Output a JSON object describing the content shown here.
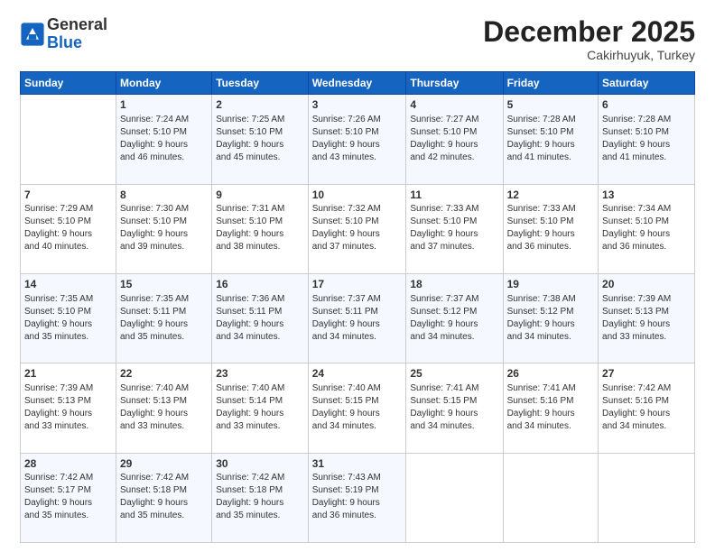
{
  "logo": {
    "general": "General",
    "blue": "Blue"
  },
  "title": {
    "month": "December 2025",
    "location": "Cakirhuyuk, Turkey"
  },
  "days_of_week": [
    "Sunday",
    "Monday",
    "Tuesday",
    "Wednesday",
    "Thursday",
    "Friday",
    "Saturday"
  ],
  "weeks": [
    [
      {
        "day": "",
        "content": ""
      },
      {
        "day": "1",
        "content": "Sunrise: 7:24 AM\nSunset: 5:10 PM\nDaylight: 9 hours\nand 46 minutes."
      },
      {
        "day": "2",
        "content": "Sunrise: 7:25 AM\nSunset: 5:10 PM\nDaylight: 9 hours\nand 45 minutes."
      },
      {
        "day": "3",
        "content": "Sunrise: 7:26 AM\nSunset: 5:10 PM\nDaylight: 9 hours\nand 43 minutes."
      },
      {
        "day": "4",
        "content": "Sunrise: 7:27 AM\nSunset: 5:10 PM\nDaylight: 9 hours\nand 42 minutes."
      },
      {
        "day": "5",
        "content": "Sunrise: 7:28 AM\nSunset: 5:10 PM\nDaylight: 9 hours\nand 41 minutes."
      },
      {
        "day": "6",
        "content": "Sunrise: 7:28 AM\nSunset: 5:10 PM\nDaylight: 9 hours\nand 41 minutes."
      }
    ],
    [
      {
        "day": "7",
        "content": "Sunrise: 7:29 AM\nSunset: 5:10 PM\nDaylight: 9 hours\nand 40 minutes."
      },
      {
        "day": "8",
        "content": "Sunrise: 7:30 AM\nSunset: 5:10 PM\nDaylight: 9 hours\nand 39 minutes."
      },
      {
        "day": "9",
        "content": "Sunrise: 7:31 AM\nSunset: 5:10 PM\nDaylight: 9 hours\nand 38 minutes."
      },
      {
        "day": "10",
        "content": "Sunrise: 7:32 AM\nSunset: 5:10 PM\nDaylight: 9 hours\nand 37 minutes."
      },
      {
        "day": "11",
        "content": "Sunrise: 7:33 AM\nSunset: 5:10 PM\nDaylight: 9 hours\nand 37 minutes."
      },
      {
        "day": "12",
        "content": "Sunrise: 7:33 AM\nSunset: 5:10 PM\nDaylight: 9 hours\nand 36 minutes."
      },
      {
        "day": "13",
        "content": "Sunrise: 7:34 AM\nSunset: 5:10 PM\nDaylight: 9 hours\nand 36 minutes."
      }
    ],
    [
      {
        "day": "14",
        "content": "Sunrise: 7:35 AM\nSunset: 5:10 PM\nDaylight: 9 hours\nand 35 minutes."
      },
      {
        "day": "15",
        "content": "Sunrise: 7:35 AM\nSunset: 5:11 PM\nDaylight: 9 hours\nand 35 minutes."
      },
      {
        "day": "16",
        "content": "Sunrise: 7:36 AM\nSunset: 5:11 PM\nDaylight: 9 hours\nand 34 minutes."
      },
      {
        "day": "17",
        "content": "Sunrise: 7:37 AM\nSunset: 5:11 PM\nDaylight: 9 hours\nand 34 minutes."
      },
      {
        "day": "18",
        "content": "Sunrise: 7:37 AM\nSunset: 5:12 PM\nDaylight: 9 hours\nand 34 minutes."
      },
      {
        "day": "19",
        "content": "Sunrise: 7:38 AM\nSunset: 5:12 PM\nDaylight: 9 hours\nand 34 minutes."
      },
      {
        "day": "20",
        "content": "Sunrise: 7:39 AM\nSunset: 5:13 PM\nDaylight: 9 hours\nand 33 minutes."
      }
    ],
    [
      {
        "day": "21",
        "content": "Sunrise: 7:39 AM\nSunset: 5:13 PM\nDaylight: 9 hours\nand 33 minutes."
      },
      {
        "day": "22",
        "content": "Sunrise: 7:40 AM\nSunset: 5:13 PM\nDaylight: 9 hours\nand 33 minutes."
      },
      {
        "day": "23",
        "content": "Sunrise: 7:40 AM\nSunset: 5:14 PM\nDaylight: 9 hours\nand 33 minutes."
      },
      {
        "day": "24",
        "content": "Sunrise: 7:40 AM\nSunset: 5:15 PM\nDaylight: 9 hours\nand 34 minutes."
      },
      {
        "day": "25",
        "content": "Sunrise: 7:41 AM\nSunset: 5:15 PM\nDaylight: 9 hours\nand 34 minutes."
      },
      {
        "day": "26",
        "content": "Sunrise: 7:41 AM\nSunset: 5:16 PM\nDaylight: 9 hours\nand 34 minutes."
      },
      {
        "day": "27",
        "content": "Sunrise: 7:42 AM\nSunset: 5:16 PM\nDaylight: 9 hours\nand 34 minutes."
      }
    ],
    [
      {
        "day": "28",
        "content": "Sunrise: 7:42 AM\nSunset: 5:17 PM\nDaylight: 9 hours\nand 35 minutes."
      },
      {
        "day": "29",
        "content": "Sunrise: 7:42 AM\nSunset: 5:18 PM\nDaylight: 9 hours\nand 35 minutes."
      },
      {
        "day": "30",
        "content": "Sunrise: 7:42 AM\nSunset: 5:18 PM\nDaylight: 9 hours\nand 35 minutes."
      },
      {
        "day": "31",
        "content": "Sunrise: 7:43 AM\nSunset: 5:19 PM\nDaylight: 9 hours\nand 36 minutes."
      },
      {
        "day": "",
        "content": ""
      },
      {
        "day": "",
        "content": ""
      },
      {
        "day": "",
        "content": ""
      }
    ]
  ]
}
